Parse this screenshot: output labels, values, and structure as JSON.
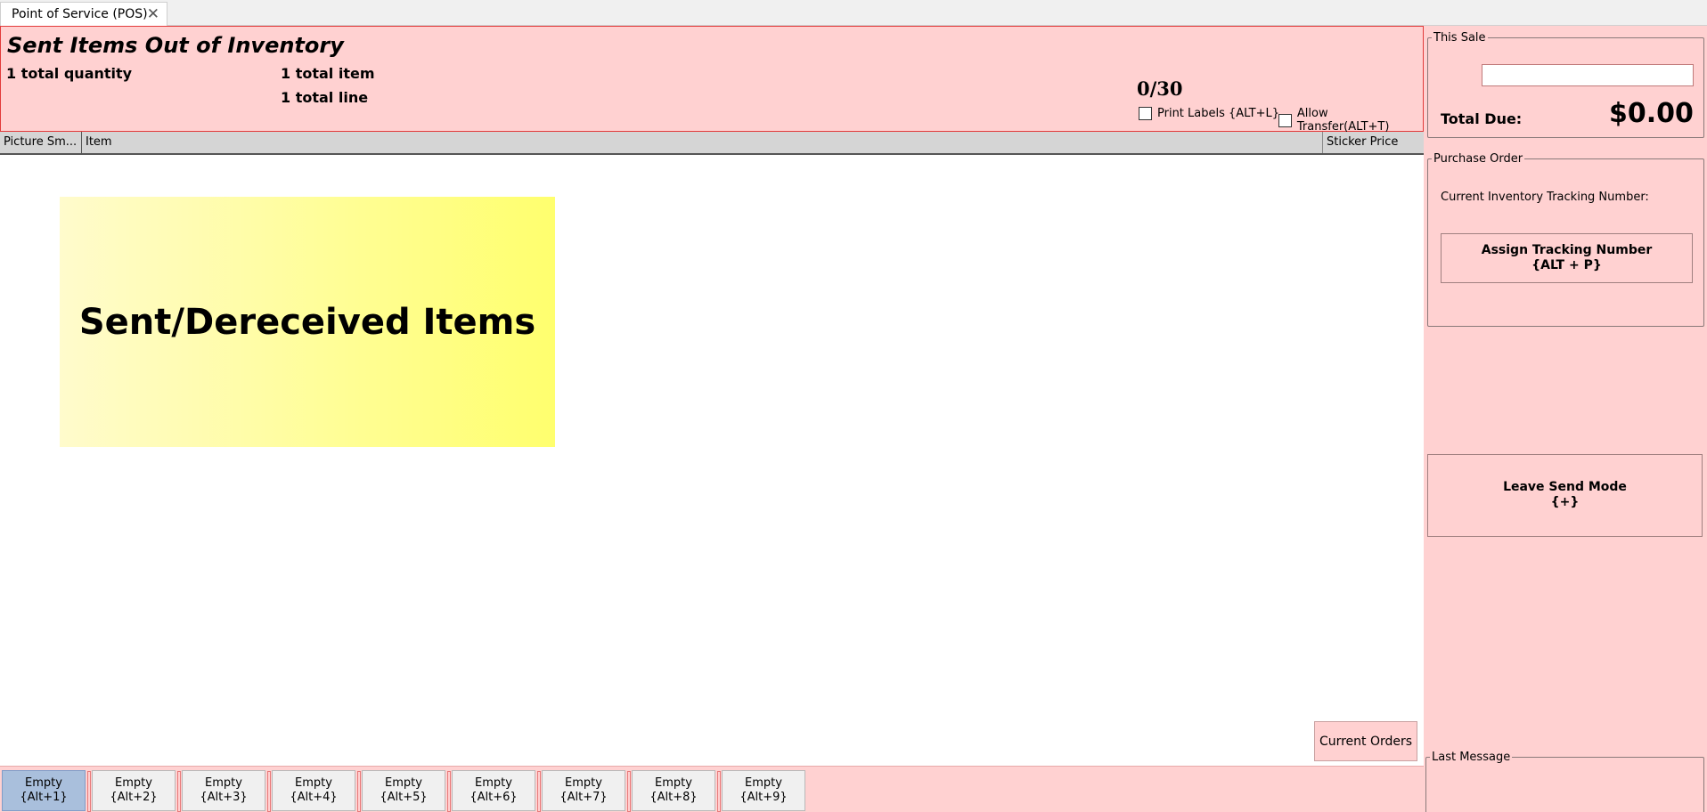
{
  "tab": {
    "label": "Point of Service (POS)",
    "close_glyph": "✕"
  },
  "header": {
    "title": "Sent Items Out of Inventory",
    "total_quantity": "1 total quantity",
    "total_items": "1 total item",
    "total_lines": "1 total line",
    "counter": "0/30",
    "print_labels": "Print Labels {ALT+L}",
    "allow_transfer": "Allow Transfer(ALT+T)"
  },
  "grid": {
    "columns": [
      "Picture Sm...",
      "Item",
      "Sticker Price"
    ],
    "banner": "Sent/Dereceived Items",
    "current_orders": "Current Orders"
  },
  "slots": [
    {
      "label": "Empty",
      "key": "{Alt+1}"
    },
    {
      "label": "Empty",
      "key": "{Alt+2}"
    },
    {
      "label": "Empty",
      "key": "{Alt+3}"
    },
    {
      "label": "Empty",
      "key": "{Alt+4}"
    },
    {
      "label": "Empty",
      "key": "{Alt+5}"
    },
    {
      "label": "Empty",
      "key": "{Alt+6}"
    },
    {
      "label": "Empty",
      "key": "{Alt+7}"
    },
    {
      "label": "Empty",
      "key": "{Alt+8}"
    },
    {
      "label": "Empty",
      "key": "{Alt+9}"
    }
  ],
  "right": {
    "this_sale_legend": "This Sale",
    "total_due_label": "Total Due:",
    "total_due_value": "$0.00",
    "purchase_order_legend": "Purchase Order",
    "tracking_label": "Current Inventory Tracking Number:",
    "assign_line1": "Assign Tracking Number",
    "assign_line2": "{ALT + P}",
    "leave_line1": "Leave Send Mode",
    "leave_line2": "{+}",
    "last_message_legend": "Last Message"
  },
  "colors": {
    "panel_pink": "#ffd1d1",
    "border_red": "#e23b3b",
    "active_slot": "#a9bfdc"
  }
}
